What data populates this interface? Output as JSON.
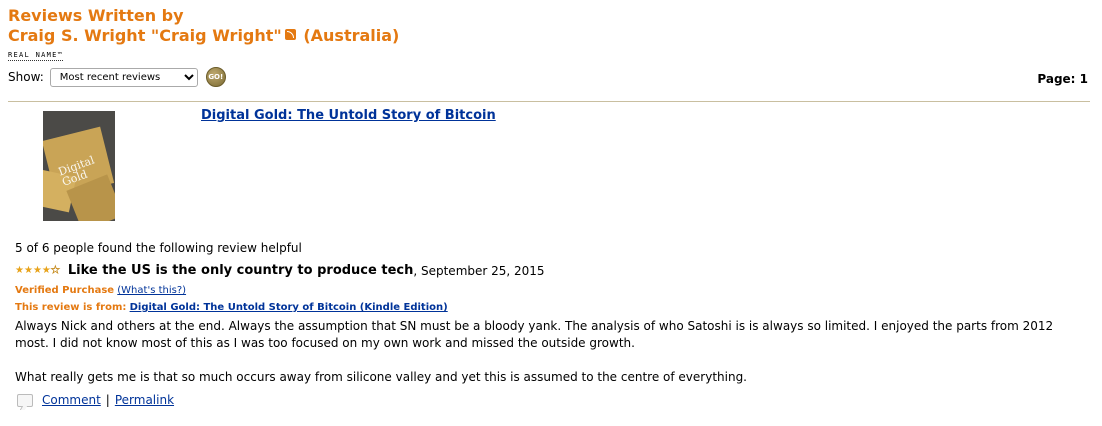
{
  "header": {
    "title_line1": "Reviews Written by",
    "title_name": "Craig S. Wright \"Craig Wright\"",
    "rss_icon": "rss-icon",
    "location": "(Australia)",
    "real_name_badge": "REAL NAME™"
  },
  "controls": {
    "show_label": "Show:",
    "sort_selected": "Most recent reviews",
    "go_label": "GO!",
    "page_label": "Page: 1"
  },
  "colors": {
    "heading": "#e47911",
    "link": "#003399",
    "divider": "#c9bfa0",
    "star": "#e8a31b"
  },
  "review": {
    "product_title": "Digital Gold: The Untold Story of Bitcoin",
    "helpful": "5 of 6 people found the following review helpful",
    "rating": 4,
    "rating_max": 5,
    "title": "Like the US is the only country to produce tech",
    "date": ", September 25, 2015",
    "verified": "Verified Purchase",
    "whats_this": "(What's this?)",
    "from_label": "This review is from:",
    "from_link": "Digital Gold: The Untold Story of Bitcoin (Kindle Edition)",
    "body_p1": "Always Nick and others at the end. Always the assumption that SN must be a bloody yank. The analysis of who Satoshi is is always so limited. I enjoyed the parts from 2012 most. I did not know most of this as I was too focused on my own work and missed the outside growth.",
    "body_p2": "What really gets me is that so much occurs away from silicone valley and yet this is assumed to the centre of everything.",
    "cover_text": "Digital Gold"
  },
  "actions": {
    "comment": "Comment",
    "separator": "|",
    "permalink": "Permalink",
    "comment_icon": "comment-bubble-icon"
  }
}
